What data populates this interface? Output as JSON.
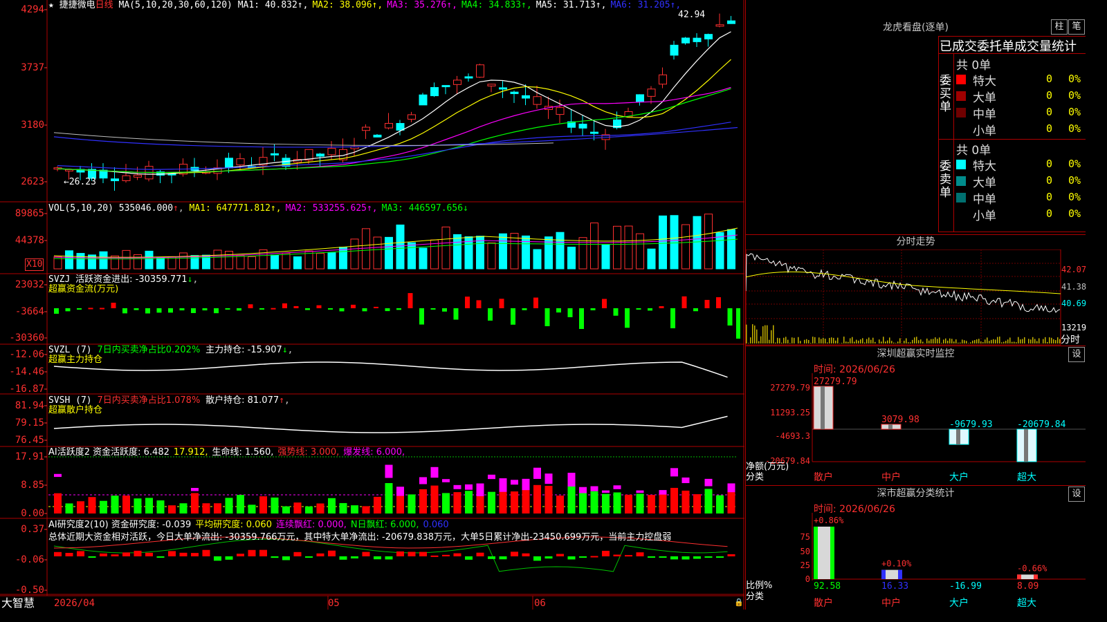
{
  "app_name": "大智慧",
  "stock": {
    "name": "捷捷微电",
    "period": "日线"
  },
  "panel1": {
    "ma_params": "MA(5,10,20,30,60,120)",
    "ma_values": [
      {
        "label": "MA1: 40.832",
        "color": "#ffffff"
      },
      {
        "label": "MA2: 38.096",
        "color": "#ffff00"
      },
      {
        "label": "MA3: 35.276",
        "color": "#ff00ff"
      },
      {
        "label": "MA4: 34.833",
        "color": "#00ff00"
      },
      {
        "label": "MA5: 31.713",
        "color": "#ffffff"
      },
      {
        "label": "MA6: 31.205",
        "color": "#3030ff"
      }
    ],
    "yticks": [
      "4294",
      "3737",
      "3180",
      "2623"
    ],
    "high_label": "42.94",
    "low_label": "←26.23"
  },
  "panel2": {
    "title": "VOL(5,10,20)",
    "value": "535046.000",
    "mas": [
      {
        "label": "MA1: 647771.812",
        "color": "#ffff00"
      },
      {
        "label": "MA2: 533255.625",
        "color": "#ff00ff"
      },
      {
        "label": "MA3: 446597.656",
        "color": "#00ff00"
      }
    ],
    "yticks": [
      "89865",
      "44378"
    ],
    "unit": "X10"
  },
  "panel3": {
    "title": "SVZJ",
    "desc": "活跃资金进出: -30359.771",
    "sub": "超赢资金流(万元)",
    "yticks": [
      "23032",
      "-3664",
      "-30360"
    ]
  },
  "panel4": {
    "title": "SVZL (7)",
    "desc1": "7日内买卖净占比0.202%",
    "desc2": "主力持仓: -15.907",
    "sub": "超赢主力持仓",
    "yticks": [
      "-12.06",
      "-14.46",
      "-16.87"
    ]
  },
  "panel5": {
    "title": "SVSH (7)",
    "desc1": "7日内买卖净占比1.078%",
    "desc2": "散户持仓: 81.077",
    "sub": "超赢散户持仓",
    "yticks": [
      "81.94",
      "79.15",
      "76.45"
    ]
  },
  "panel6": {
    "title": "AI活跃度2",
    "parts": [
      {
        "label": "资金活跃度: 6.482",
        "color": "#ffffff"
      },
      {
        "label": "17.912,",
        "color": "#ffff00"
      },
      {
        "label": "生命线: 1.560,",
        "color": "#ffffff"
      },
      {
        "label": "强势线: 3.000,",
        "color": "#ff3030"
      },
      {
        "label": "爆发线: 6.000,",
        "color": "#ff00ff"
      }
    ],
    "yticks": [
      "17.91",
      "8.85",
      "0.00"
    ]
  },
  "panel7": {
    "title": "AI研究度2(10)",
    "parts": [
      {
        "label": "资金研究度: -0.039",
        "color": "#ffffff"
      },
      {
        "label": "平均研究度: 0.060",
        "color": "#ffff00"
      },
      {
        "label": "连续飘红: 0.000,",
        "color": "#ff00ff"
      },
      {
        "label": "N日飘红: 6.000,",
        "color": "#00ff00"
      },
      {
        "label": "0.060",
        "color": "#3030ff"
      }
    ],
    "summary": "总体近期大资金相对活跃，今日大单净流出: -30359.766万元，其中特大单净流出: -20679.838万元，大单5日累计净出-23450.699万元，当前主力控盘弱",
    "yticks": [
      "0.37",
      "-0.06",
      "-0.50"
    ]
  },
  "xaxis": {
    "date": "2026/04",
    "m5": "05",
    "m6": "06"
  },
  "longhu": {
    "title": "龙虎看盘(逐单)",
    "btn_zhu": "柱",
    "btn_bi": "笔",
    "header": "已成交委托单成交量统计",
    "buy_label": "委买单",
    "sell_label": "委卖单",
    "buy_total": "共 0单",
    "sell_total": "共 0单",
    "buy_rows": [
      {
        "label": "特大",
        "value": "0",
        "pct": "0%",
        "color": "#ff0000"
      },
      {
        "label": "大单",
        "value": "0",
        "pct": "0%",
        "color": "#a00000"
      },
      {
        "label": "中单",
        "value": "0",
        "pct": "0%",
        "color": "#700000"
      },
      {
        "label": "小单",
        "value": "0",
        "pct": "0%",
        "color": ""
      }
    ],
    "sell_rows": [
      {
        "label": "特大",
        "value": "0",
        "pct": "0%",
        "color": "#00ffff"
      },
      {
        "label": "大单",
        "value": "0",
        "pct": "0%",
        "color": "#008c8c"
      },
      {
        "label": "中单",
        "value": "0",
        "pct": "0%",
        "color": "#007070"
      },
      {
        "label": "小单",
        "value": "0",
        "pct": "0%",
        "color": ""
      }
    ]
  },
  "fenshi": {
    "title": "分时走势",
    "yticks": [
      "42.07",
      "41.38",
      "40.69",
      "13219"
    ],
    "unit": "分时"
  },
  "monitor": {
    "title": "深圳超赢实时监控",
    "btn": "设",
    "time": "时间: 2026/06/26",
    "yticks": [
      "27279.79",
      "11293.25",
      "-4693.3",
      "-20679.84"
    ],
    "ylabel": "净额(万元)",
    "xlabel": "分类",
    "bars": [
      {
        "cat": "散户",
        "value": 27279.79,
        "label": "27279.79"
      },
      {
        "cat": "中户",
        "value": 3079.98,
        "label": "3079.98"
      },
      {
        "cat": "大户",
        "value": -9679.93,
        "label": "-9679.93"
      },
      {
        "cat": "超大",
        "value": -20679.84,
        "label": "-20679.84"
      }
    ]
  },
  "classify": {
    "title": "深市超赢分类统计",
    "btn": "设",
    "time": "时间: 2026/06/26",
    "yticks": [
      "75",
      "50",
      "25",
      "0"
    ],
    "ylabel": "比例%",
    "xlabel": "分类",
    "bars": [
      {
        "cat": "散户",
        "value": 92.58,
        "label": "92.58",
        "delta": "+0.86%"
      },
      {
        "cat": "中户",
        "value": 16.33,
        "label": "16.33",
        "delta": "+0.10%"
      },
      {
        "cat": "大户",
        "value": -16.99,
        "label": "-16.99",
        "delta": ""
      },
      {
        "cat": "超大",
        "value": 8.09,
        "label": "8.09",
        "delta": "-0.66%"
      }
    ]
  }
}
